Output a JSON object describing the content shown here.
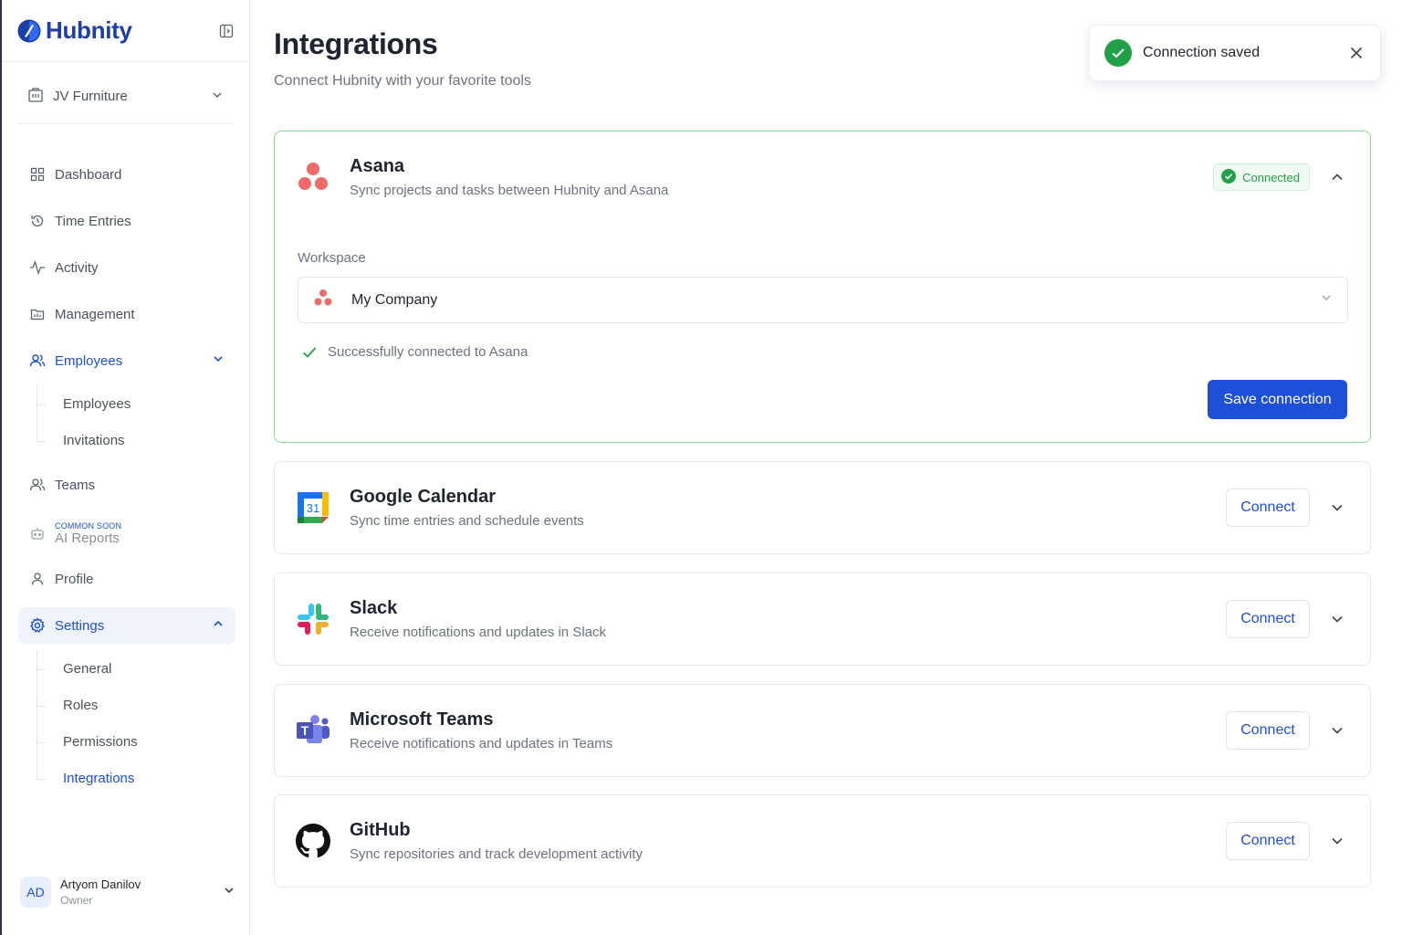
{
  "brand": {
    "name": "Hubnity",
    "color": "#1b3faa"
  },
  "organization": {
    "name": "JV Furniture"
  },
  "nav": {
    "dashboard": "Dashboard",
    "time_entries": "Time Entries",
    "activity": "Activity",
    "management": "Management",
    "employees": "Employees",
    "employees_sub": [
      "Employees",
      "Invitations"
    ],
    "teams": "Teams",
    "ai_reports_tag": "COMMON SOON",
    "ai_reports": "AI Reports",
    "profile": "Profile",
    "settings": "Settings",
    "settings_sub": [
      "General",
      "Roles",
      "Permissions",
      "Integrations"
    ],
    "current_settings_sub": "Integrations"
  },
  "user": {
    "initials": "AD",
    "name": "Artyom Danilov",
    "role": "Owner"
  },
  "page": {
    "title": "Integrations",
    "subtitle": "Connect Hubnity with your favorite tools"
  },
  "toast": {
    "message": "Connection saved"
  },
  "integrations": [
    {
      "name": "Asana",
      "description": "Sync projects and tasks between Hubnity and Asana",
      "icon": "asana-icon",
      "status": "Connected",
      "expanded": true,
      "workspace_label": "Workspace",
      "workspace_value": "My Company",
      "success_message": "Successfully connected to Asana",
      "save_label": "Save connection"
    },
    {
      "name": "Google Calendar",
      "description": "Sync time entries and schedule events",
      "icon": "google-calendar-icon",
      "connect_label": "Connect"
    },
    {
      "name": "Slack",
      "description": "Receive notifications and updates in Slack",
      "icon": "slack-icon",
      "connect_label": "Connect"
    },
    {
      "name": "Microsoft Teams",
      "description": "Receive notifications and updates in Teams",
      "icon": "microsoft-teams-icon",
      "connect_label": "Connect"
    },
    {
      "name": "GitHub",
      "description": "Sync repositories and track development activity",
      "icon": "github-icon",
      "connect_label": "Connect"
    }
  ],
  "colors": {
    "accent": "#1d4fd7",
    "success": "#22a047",
    "asana": "#f06a6a"
  }
}
